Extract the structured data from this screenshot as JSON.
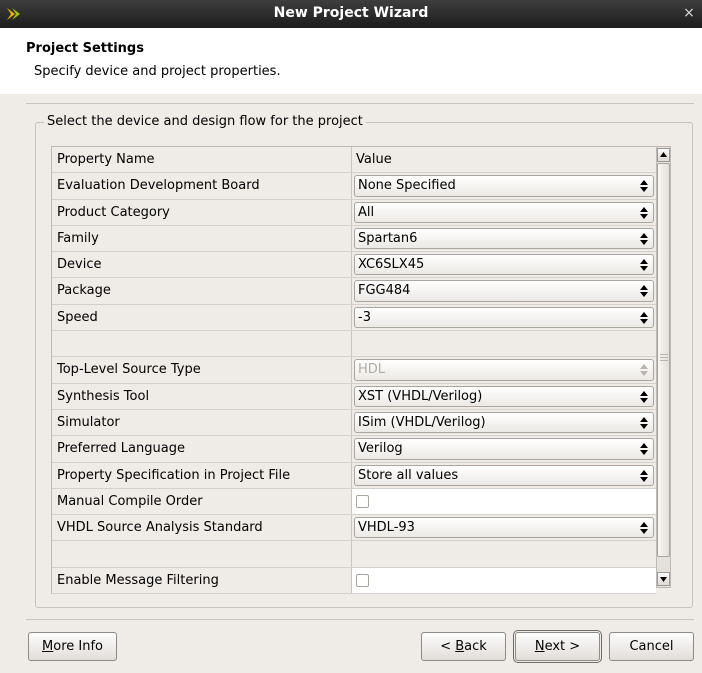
{
  "window": {
    "title": "New Project Wizard",
    "close_glyph": "×",
    "app_icon": "xilinx-logo-icon"
  },
  "header": {
    "title": "Project Settings",
    "subtitle": "Specify device and project properties."
  },
  "group": {
    "legend": "Select the device and design flow for the project"
  },
  "table": {
    "header": {
      "name": "Property Name",
      "value": "Value"
    },
    "rows": [
      {
        "name": "Evaluation Development Board",
        "value": "None Specified",
        "type": "combo"
      },
      {
        "name": "Product Category",
        "value": "All",
        "type": "combo"
      },
      {
        "name": "Family",
        "value": "Spartan6",
        "type": "combo"
      },
      {
        "name": "Device",
        "value": "XC6SLX45",
        "type": "combo"
      },
      {
        "name": "Package",
        "value": "FGG484",
        "type": "combo"
      },
      {
        "name": "Speed",
        "value": "-3",
        "type": "combo"
      },
      {
        "name": "",
        "value": "",
        "type": "blank"
      },
      {
        "name": "Top-Level Source Type",
        "value": "HDL",
        "type": "combo-disabled"
      },
      {
        "name": "Synthesis Tool",
        "value": "XST (VHDL/Verilog)",
        "type": "combo"
      },
      {
        "name": "Simulator",
        "value": "ISim (VHDL/Verilog)",
        "type": "combo"
      },
      {
        "name": "Preferred Language",
        "value": "Verilog",
        "type": "combo"
      },
      {
        "name": "Property Specification in Project File",
        "value": "Store all values",
        "type": "combo"
      },
      {
        "name": "Manual Compile Order",
        "value": "",
        "type": "checkbox",
        "checked": false
      },
      {
        "name": "VHDL Source Analysis Standard",
        "value": "VHDL-93",
        "type": "combo"
      },
      {
        "name": "",
        "value": "",
        "type": "blank"
      },
      {
        "name": "Enable Message Filtering",
        "value": "",
        "type": "checkbox",
        "checked": false
      }
    ]
  },
  "buttons": {
    "more_info": {
      "mnemonic": "M",
      "rest": "ore Info"
    },
    "back": {
      "prefix": "< ",
      "mnemonic": "B",
      "rest": "ack"
    },
    "next": {
      "mnemonic": "N",
      "rest": "ext >"
    },
    "cancel": "Cancel"
  },
  "colors": {
    "titlebar": "#2b2b2b",
    "dialog_bg": "#efebe7",
    "header_bg": "#ffffff",
    "logo_accent": "#e2a300"
  }
}
